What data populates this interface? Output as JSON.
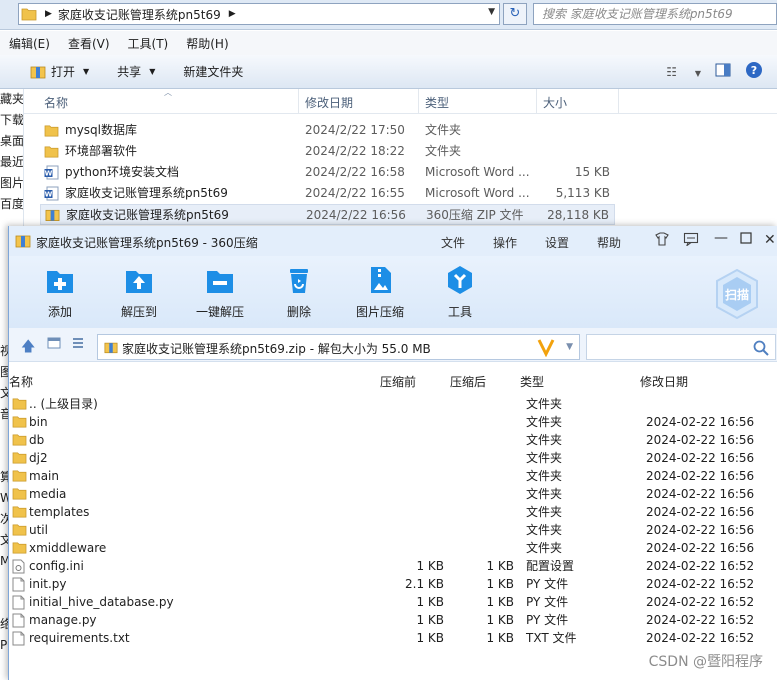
{
  "explorer": {
    "address": "家庭收支记账管理系统pn5t69",
    "search_placeholder": "搜索 家庭收支记账管理系统pn5t69",
    "menu": [
      "编辑(E)",
      "查看(V)",
      "工具(T)",
      "帮助(H)"
    ],
    "commands": {
      "open": "打开",
      "share": "共享",
      "new_folder": "新建文件夹"
    },
    "nav_items": [
      "藏夹",
      "下载",
      "桌面",
      "最近访",
      "图片",
      "百度网",
      "",
      "",
      "",
      "",
      "",
      "",
      "视",
      "图",
      "文",
      "音",
      "",
      "",
      "算",
      "W",
      "次",
      "文",
      "M",
      "",
      "",
      "络",
      "PC"
    ],
    "columns": {
      "name": "名称",
      "modified": "修改日期",
      "type": "类型",
      "size": "大小"
    },
    "files": [
      {
        "name": "mysql数据库",
        "date": "2024/2/22 17:50",
        "type": "文件夹",
        "size": "",
        "icon": "folder-icon"
      },
      {
        "name": "环境部署软件",
        "date": "2024/2/22 18:22",
        "type": "文件夹",
        "size": "",
        "icon": "folder-icon"
      },
      {
        "name": "python环境安装文档",
        "date": "2024/2/22 16:58",
        "type": "Microsoft Word ...",
        "size": "15 KB",
        "icon": "word-doc-icon"
      },
      {
        "name": "家庭收支记账管理系统pn5t69",
        "date": "2024/2/22 16:55",
        "type": "Microsoft Word ...",
        "size": "5,113 KB",
        "icon": "word-doc-icon"
      },
      {
        "name": "家庭收支记账管理系统pn5t69",
        "date": "2024/2/22 16:56",
        "type": "360压缩 ZIP 文件",
        "size": "28,118 KB",
        "icon": "zip-archive-icon",
        "selected": true
      }
    ]
  },
  "zip": {
    "title": "家庭收支记账管理系统pn5t69 - 360压缩",
    "menu": [
      "文件",
      "操作",
      "设置",
      "帮助"
    ],
    "tools": [
      "添加",
      "解压到",
      "一键解压",
      "删除",
      "图片压缩",
      "工具"
    ],
    "scan_label": "扫描",
    "path": "家庭收支记账管理系统pn5t69.zip - 解包大小为 55.0 MB",
    "columns": {
      "name": "名称",
      "compressed": "压缩前",
      "uncompressed": "压缩后",
      "type": "类型",
      "modified": "修改日期"
    },
    "rows": [
      {
        "name": ".. (上级目录)",
        "before": "",
        "after": "",
        "type": "文件夹",
        "date": "",
        "icon": "folder-icon"
      },
      {
        "name": "bin",
        "before": "",
        "after": "",
        "type": "文件夹",
        "date": "2024-02-22 16:56",
        "icon": "folder-icon"
      },
      {
        "name": "db",
        "before": "",
        "after": "",
        "type": "文件夹",
        "date": "2024-02-22 16:56",
        "icon": "folder-icon"
      },
      {
        "name": "dj2",
        "before": "",
        "after": "",
        "type": "文件夹",
        "date": "2024-02-22 16:56",
        "icon": "folder-icon"
      },
      {
        "name": "main",
        "before": "",
        "after": "",
        "type": "文件夹",
        "date": "2024-02-22 16:56",
        "icon": "folder-icon"
      },
      {
        "name": "media",
        "before": "",
        "after": "",
        "type": "文件夹",
        "date": "2024-02-22 16:56",
        "icon": "folder-icon"
      },
      {
        "name": "templates",
        "before": "",
        "after": "",
        "type": "文件夹",
        "date": "2024-02-22 16:56",
        "icon": "folder-icon"
      },
      {
        "name": "util",
        "before": "",
        "after": "",
        "type": "文件夹",
        "date": "2024-02-22 16:56",
        "icon": "folder-icon"
      },
      {
        "name": "xmiddleware",
        "before": "",
        "after": "",
        "type": "文件夹",
        "date": "2024-02-22 16:56",
        "icon": "folder-icon"
      },
      {
        "name": "config.ini",
        "before": "1 KB",
        "after": "1 KB",
        "type": "配置设置",
        "date": "2024-02-22 16:52",
        "icon": "config-file-icon"
      },
      {
        "name": "init.py",
        "before": "2.1 KB",
        "after": "1 KB",
        "type": "PY 文件",
        "date": "2024-02-22 16:52",
        "icon": "file-icon"
      },
      {
        "name": "initial_hive_database.py",
        "before": "1 KB",
        "after": "1 KB",
        "type": "PY 文件",
        "date": "2024-02-22 16:52",
        "icon": "file-icon"
      },
      {
        "name": "manage.py",
        "before": "1 KB",
        "after": "1 KB",
        "type": "PY 文件",
        "date": "2024-02-22 16:52",
        "icon": "file-icon"
      },
      {
        "name": "requirements.txt",
        "before": "1 KB",
        "after": "1 KB",
        "type": "TXT 文件",
        "date": "2024-02-22 16:52",
        "icon": "file-icon"
      }
    ]
  },
  "watermark": "CSDN @暨阳程序"
}
